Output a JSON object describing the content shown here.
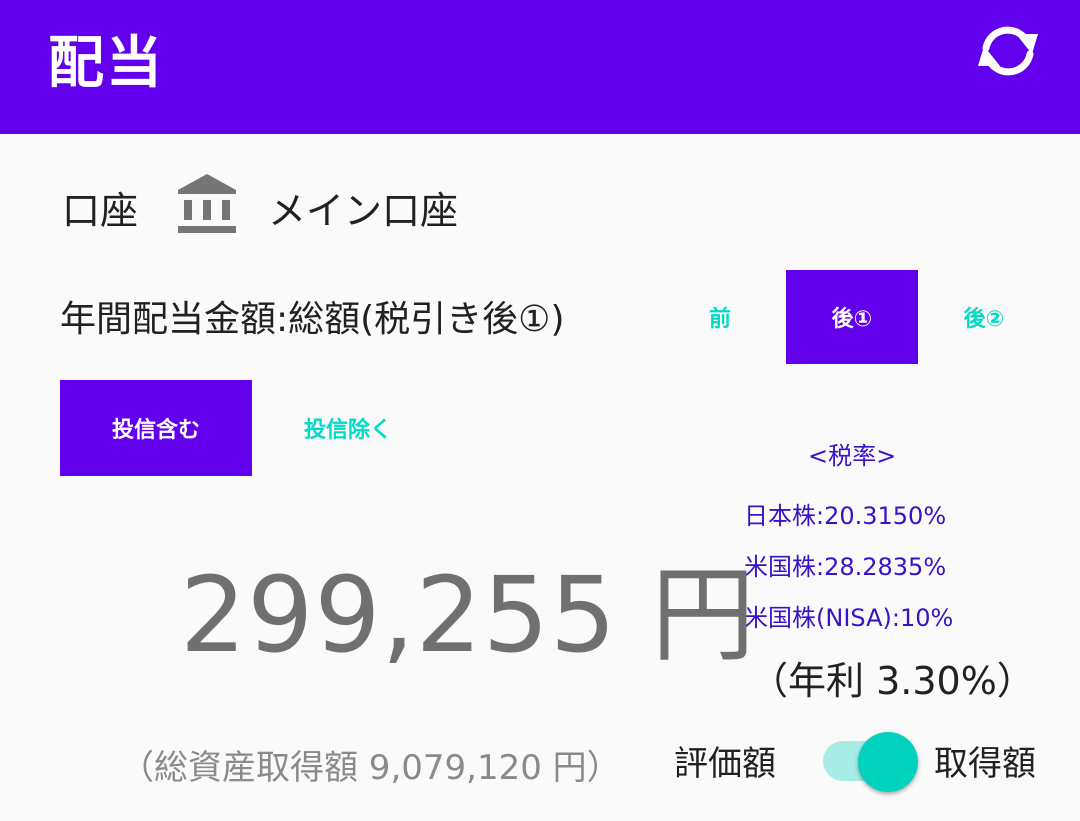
{
  "appbar": {
    "title": "配当",
    "refresh_icon": "refresh-icon",
    "color": "#6200ee"
  },
  "account": {
    "label": "口座",
    "icon": "bank-icon",
    "name": "メイン口座"
  },
  "annual": {
    "label": "年間配当金額:総額(税引き後①)"
  },
  "tax_toggle": {
    "before": "前",
    "after1": "後①",
    "after2": "後②",
    "selected": "後①"
  },
  "fund_toggle": {
    "include": "投信含む",
    "exclude": "投信除く",
    "selected": "投信含む"
  },
  "tax_rates": {
    "title": "<税率>",
    "japan": "日本株:20.3150%",
    "us": "米国株:28.2835%",
    "us_nisa": "米国株(NISA):10%"
  },
  "amount": "299,255 円",
  "yield": "（年利 3.30%）",
  "total_assets": "（総資産取得額 9,079,120 円）",
  "value_switch": {
    "left_label": "評価額",
    "right_label": "取得額",
    "on": true
  },
  "colors": {
    "primary": "#6200ee",
    "accent": "#03dac5",
    "tax_text": "#3a10c9"
  }
}
